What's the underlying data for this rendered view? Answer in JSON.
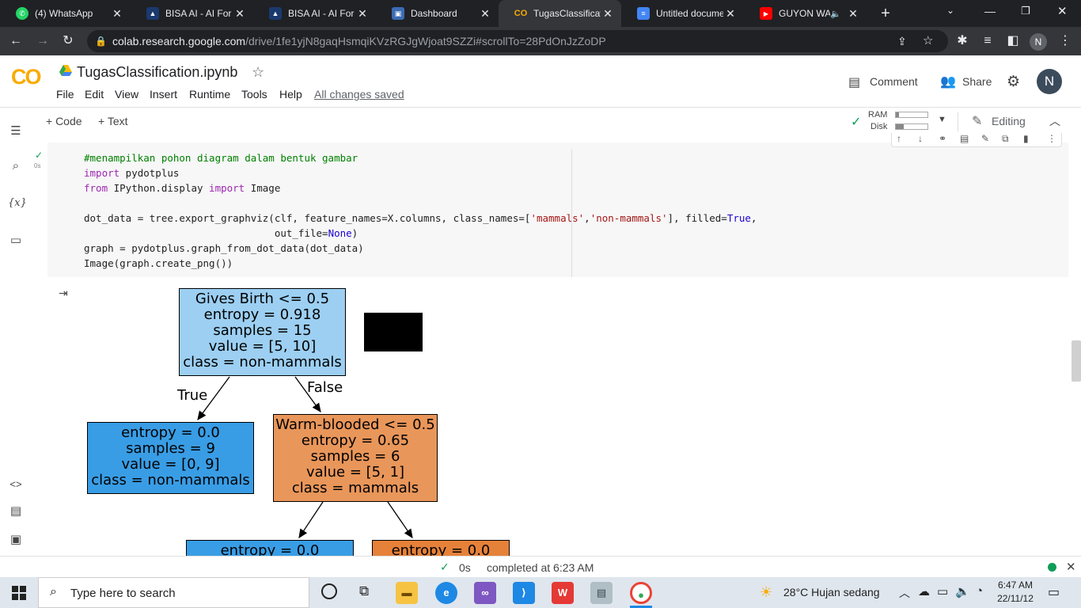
{
  "browser": {
    "tabs": [
      {
        "title": "(4) WhatsApp",
        "icon": "whatsapp-icon"
      },
      {
        "title": "BISA AI - AI For E",
        "icon": "bisaai-icon"
      },
      {
        "title": "BISA AI - AI For E",
        "icon": "bisaai-icon"
      },
      {
        "title": "Dashboard",
        "icon": "dashboard-icon"
      },
      {
        "title": "TugasClassificatio",
        "icon": "colab-icon"
      },
      {
        "title": "Untitled docume",
        "icon": "docs-icon"
      },
      {
        "title": "GUYON WAT",
        "icon": "youtube-icon"
      }
    ],
    "new_tab": "+",
    "url_host": "colab.research.google.com",
    "url_path": "/drive/1fe1yjN8gaqHsmqiKVzRGJgWjoat9SZZi#scrollTo=28PdOnJzZoDP",
    "profile_initial": "N"
  },
  "colab": {
    "logo": "CO",
    "notebook_name": "TugasClassification.ipynb",
    "menu": [
      "File",
      "Edit",
      "View",
      "Insert",
      "Runtime",
      "Tools",
      "Help"
    ],
    "save_status": "All changes saved",
    "comment_label": "Comment",
    "share_label": "Share",
    "avatar_initial": "N",
    "add_code": "+ Code",
    "add_text": "+ Text",
    "ram_label": "RAM",
    "disk_label": "Disk",
    "editing_label": "Editing",
    "cell_exec_time": "0s",
    "variables_icon_text": "{x}"
  },
  "code_lines": {
    "l1": "#menampilkan pohon diagram dalam bentuk gambar",
    "l2_kw": "import",
    "l2_rest": " pydotplus",
    "l3_kw1": "from",
    "l3_mid": " IPython.display ",
    "l3_kw2": "import",
    "l3_rest": " Image",
    "l5_a": "dot_data = tree.export_graphviz(clf, feature_names=X.columns, class_names=[",
    "l5_s1": "'mammals'",
    "l5_comma": ",",
    "l5_s2": "'non-mammals'",
    "l5_b": "], filled=",
    "l5_true": "True",
    "l5_c": ",",
    "l6_a": "                                out_file=",
    "l6_none": "None",
    "l6_b": ")",
    "l7": "graph = pydotplus.graph_from_dot_data(dot_data)",
    "l8": "Image(graph.create_png())"
  },
  "tree": {
    "root": [
      "Gives Birth <= 0.5",
      "entropy = 0.918",
      "samples = 15",
      "value = [5, 10]",
      "class = non-mammals"
    ],
    "true_label": "True",
    "false_label": "False",
    "left": [
      "entropy = 0.0",
      "samples = 9",
      "value = [0, 9]",
      "class = non-mammals"
    ],
    "right": [
      "Warm-blooded <= 0.5",
      "entropy = 0.65",
      "samples = 6",
      "value = [5, 1]",
      "class = mammals"
    ],
    "rl": [
      "entropy = 0.0"
    ],
    "rr": [
      "entropy = 0.0"
    ],
    "colors": {
      "blue_light": "#9ccff2",
      "blue": "#399de5",
      "orange": "#e9965a",
      "orange_dark": "#e58139"
    }
  },
  "status": {
    "check": "✓",
    "time": "0s",
    "completed": "completed at 6:23 AM"
  },
  "taskbar": {
    "search_placeholder": "Type here to search",
    "weather": "28°C  Hujan sedang",
    "clock_time": "6:47 AM",
    "clock_date": "22/11/12"
  }
}
